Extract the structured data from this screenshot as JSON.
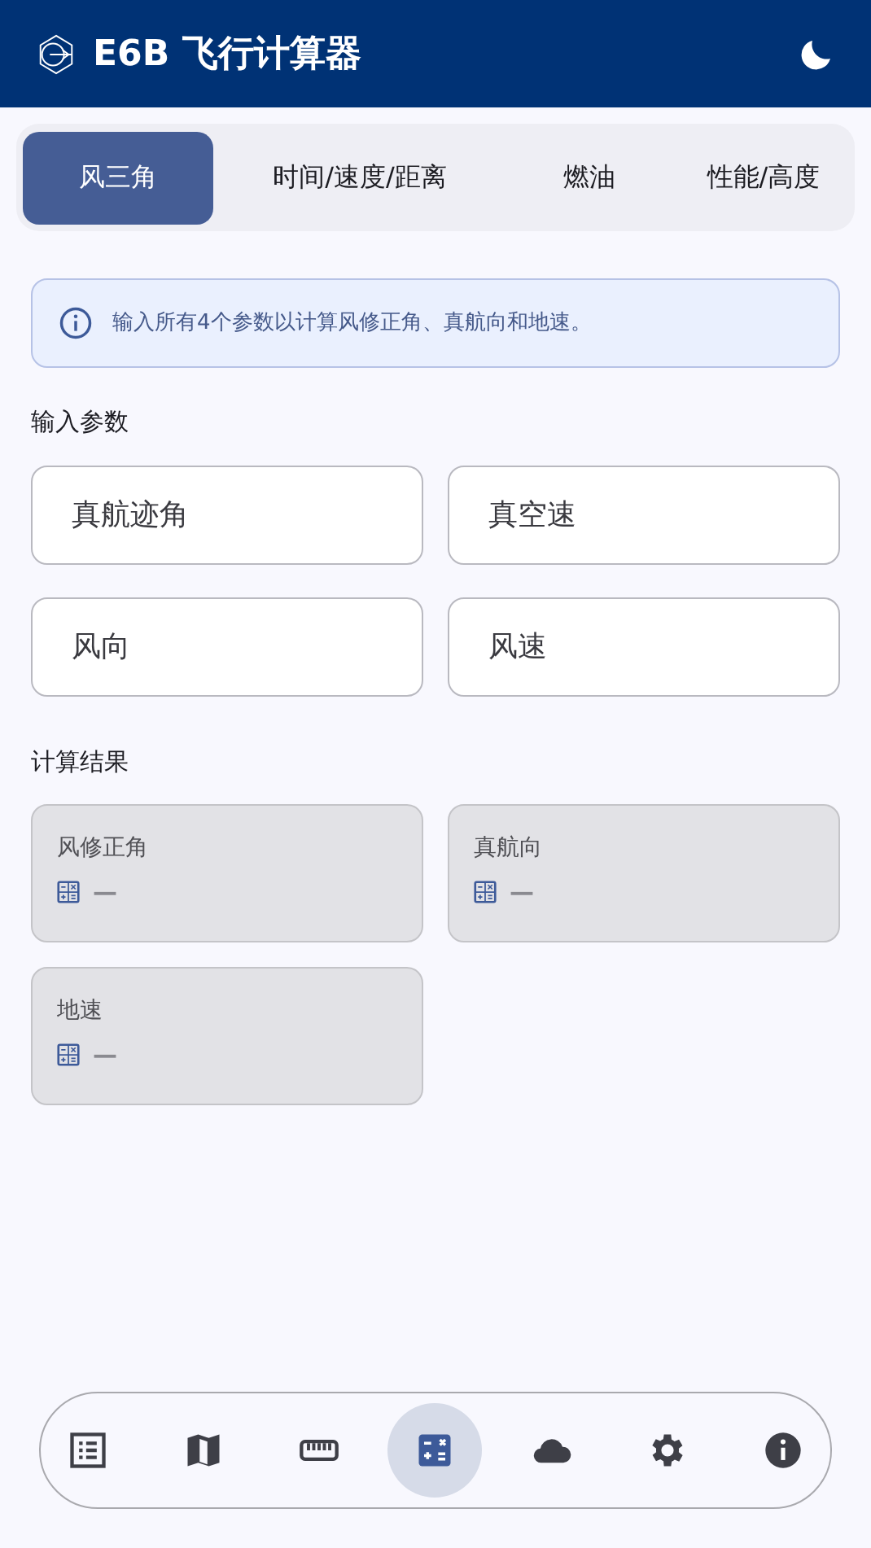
{
  "app_bar": {
    "title": "E6B 飞行计算器"
  },
  "tabs": [
    {
      "label": "风三角",
      "selected": true
    },
    {
      "label": "时间/速度/距离",
      "selected": false
    },
    {
      "label": "燃油",
      "selected": false
    },
    {
      "label": "性能/高度",
      "selected": false
    }
  ],
  "info_banner": {
    "text": "输入所有4个参数以计算风修正角、真航向和地速。"
  },
  "inputs_section": {
    "heading": "输入参数",
    "fields": [
      {
        "placeholder": "真航迹角"
      },
      {
        "placeholder": "真空速"
      },
      {
        "placeholder": "风向"
      },
      {
        "placeholder": "风速"
      }
    ]
  },
  "results_section": {
    "heading": "计算结果",
    "results": [
      {
        "label": "风修正角",
        "value": "—"
      },
      {
        "label": "真航向",
        "value": "—"
      },
      {
        "label": "地速",
        "value": "—"
      }
    ]
  },
  "bottom_nav": [
    {
      "selected": false
    },
    {
      "selected": false
    },
    {
      "selected": false
    },
    {
      "selected": true
    },
    {
      "selected": false
    },
    {
      "selected": false
    },
    {
      "selected": false
    }
  ]
}
